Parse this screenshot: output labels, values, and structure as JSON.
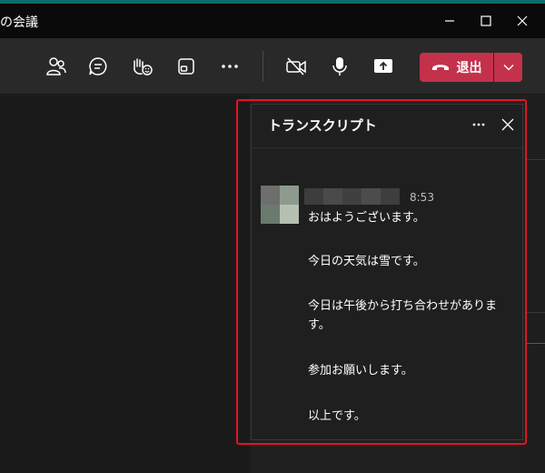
{
  "window": {
    "title": "の会議"
  },
  "toolbar": {
    "leave_label": "退出"
  },
  "transcript": {
    "title": "トランスクリプト",
    "timestamp": "8:53",
    "messages": [
      "おはようございます。",
      "今日の天気は雪です。",
      "今日は午後から打ち合わせがあります。",
      "参加お願いします。",
      "以上です。"
    ]
  },
  "colors": {
    "leave_button": "#c4314b",
    "highlight_border": "#e81123",
    "toolbar_bg": "#292929",
    "titlebar_bg": "#0a0a0a"
  }
}
